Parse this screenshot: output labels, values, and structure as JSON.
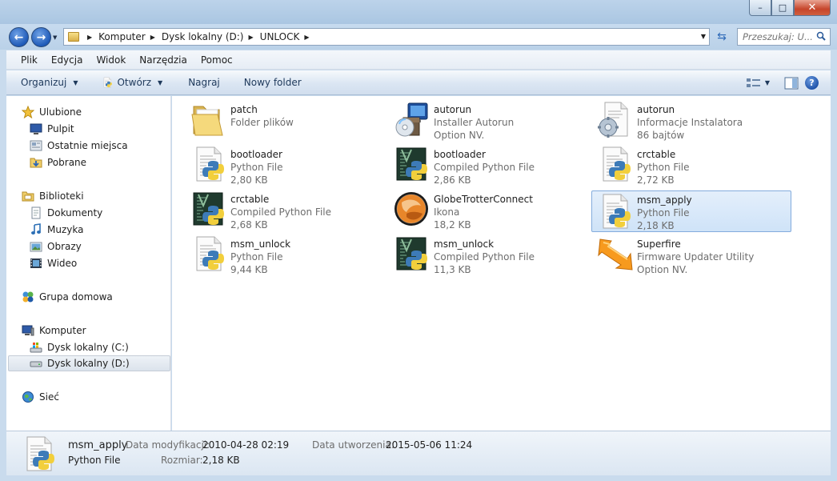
{
  "window": {
    "min_glyph": "–",
    "max_glyph": "□",
    "close_glyph": "✕"
  },
  "address": {
    "crumbs": [
      "Komputer",
      "Dysk lokalny (D:)",
      "UNLOCK"
    ],
    "search_placeholder": "Przeszukaj: U..."
  },
  "menu": [
    "Plik",
    "Edycja",
    "Widok",
    "Narzędzia",
    "Pomoc"
  ],
  "toolbar": {
    "organize": "Organizuj",
    "open": "Otwórz",
    "burn": "Nagraj",
    "new_folder": "Nowy folder"
  },
  "nav": {
    "favorites": "Ulubione",
    "desktop": "Pulpit",
    "recent": "Ostatnie miejsca",
    "downloads": "Pobrane",
    "libraries": "Biblioteki",
    "documents": "Dokumenty",
    "music": "Muzyka",
    "pictures": "Obrazy",
    "videos": "Wideo",
    "homegroup": "Grupa domowa",
    "computer": "Komputer",
    "drive_c": "Dysk lokalny (C:)",
    "drive_d": "Dysk lokalny (D:)",
    "network": "Sieć"
  },
  "files": [
    {
      "name": "patch",
      "type": "Folder plików",
      "size": "",
      "icon": "folder"
    },
    {
      "name": "autorun",
      "type": "Installer Autorun",
      "size": "Option NV.",
      "icon": "installer"
    },
    {
      "name": "autorun",
      "type": "Informacje Instalatora",
      "size": "86 bajtów",
      "icon": "setup-info"
    },
    {
      "name": "bootloader",
      "type": "Python File",
      "size": "2,80 KB",
      "icon": "python"
    },
    {
      "name": "bootloader",
      "type": "Compiled Python File",
      "size": "2,86 KB",
      "icon": "python-compiled"
    },
    {
      "name": "crctable",
      "type": "Python File",
      "size": "2,72 KB",
      "icon": "python"
    },
    {
      "name": "crctable",
      "type": "Compiled Python File",
      "size": "2,68 KB",
      "icon": "python-compiled"
    },
    {
      "name": "GlobeTrotterConnect",
      "type": "Ikona",
      "size": "18,2 KB",
      "icon": "globe"
    },
    {
      "name": "msm_apply",
      "type": "Python File",
      "size": "2,18 KB",
      "icon": "python",
      "selected": true
    },
    {
      "name": "msm_unlock",
      "type": "Python File",
      "size": "9,44 KB",
      "icon": "python"
    },
    {
      "name": "msm_unlock",
      "type": "Compiled Python File",
      "size": "11,3 KB",
      "icon": "python-compiled"
    },
    {
      "name": "Superfire",
      "type": "Firmware Updater Utility",
      "size": "Option NV.",
      "icon": "superfire"
    }
  ],
  "details": {
    "name": "msm_apply",
    "type": "Python File",
    "modified_label": "Data modyfikacji:",
    "modified": "2010-04-28 02:19",
    "created_label": "Data utworzenia:",
    "created": "2015-05-06 11:24",
    "size_label": "Rozmiar:",
    "size": "2,18 KB"
  }
}
